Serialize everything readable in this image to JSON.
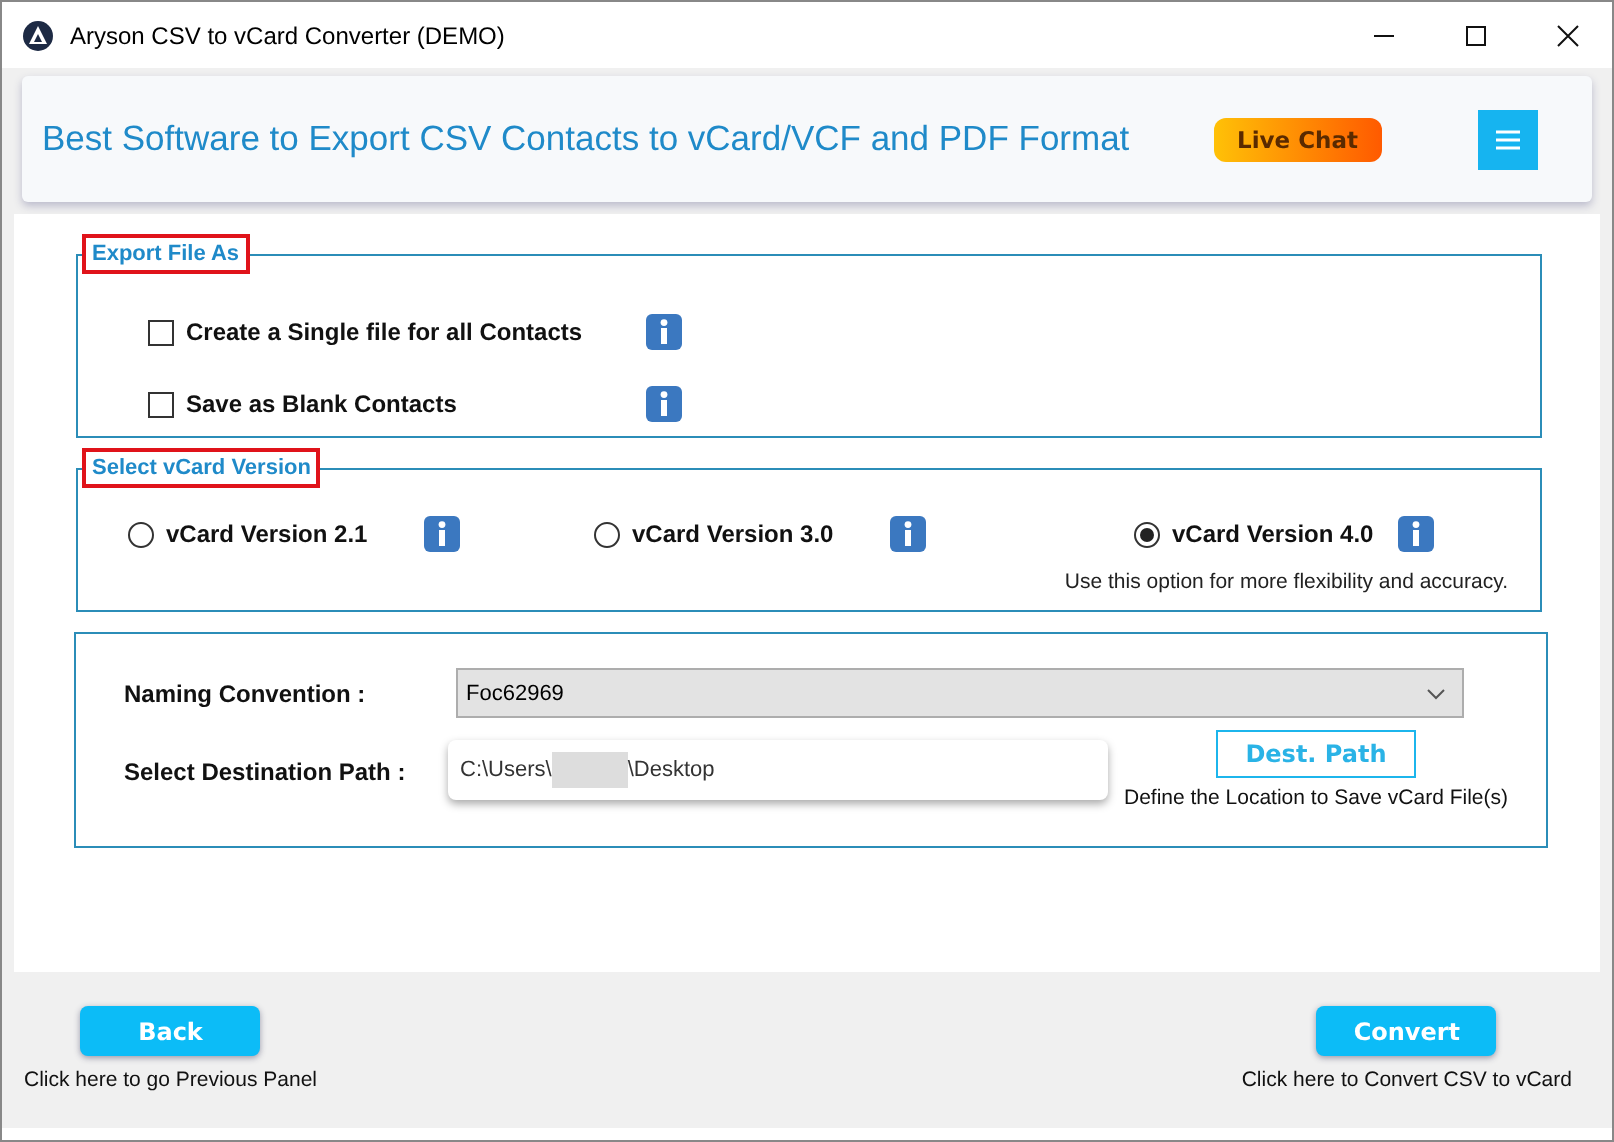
{
  "window": {
    "title": "Aryson CSV to vCard Converter (DEMO)"
  },
  "header": {
    "headline": "Best Software to Export CSV Contacts to vCard/VCF and PDF Format",
    "live_chat": "Live Chat"
  },
  "export_section": {
    "legend": "Export File As",
    "highlighted": true,
    "options": [
      {
        "label": "Create a Single file for all Contacts",
        "checked": false
      },
      {
        "label": "Save as Blank Contacts",
        "checked": false
      }
    ]
  },
  "version_section": {
    "legend": "Select vCard Version",
    "highlighted": true,
    "options": [
      {
        "label": "vCard Version 2.1",
        "selected": false
      },
      {
        "label": "vCard Version 3.0",
        "selected": false
      },
      {
        "label": "vCard Version 4.0",
        "selected": true
      }
    ],
    "hint": "Use this option for more flexibility and accuracy."
  },
  "output_section": {
    "naming_label": "Naming Convention :",
    "naming_value": "Foc62969",
    "path_label": "Select Destination Path :",
    "path_start": "C:\\Users\\",
    "path_end": "\\Desktop",
    "dest_button": "Dest. Path",
    "dest_hint": "Define the Location to Save vCard File(s)"
  },
  "footer": {
    "back_button": "Back",
    "back_hint": "Click here to go Previous Panel",
    "convert_button": "Convert",
    "convert_hint": "Click here to Convert CSV to vCard"
  }
}
